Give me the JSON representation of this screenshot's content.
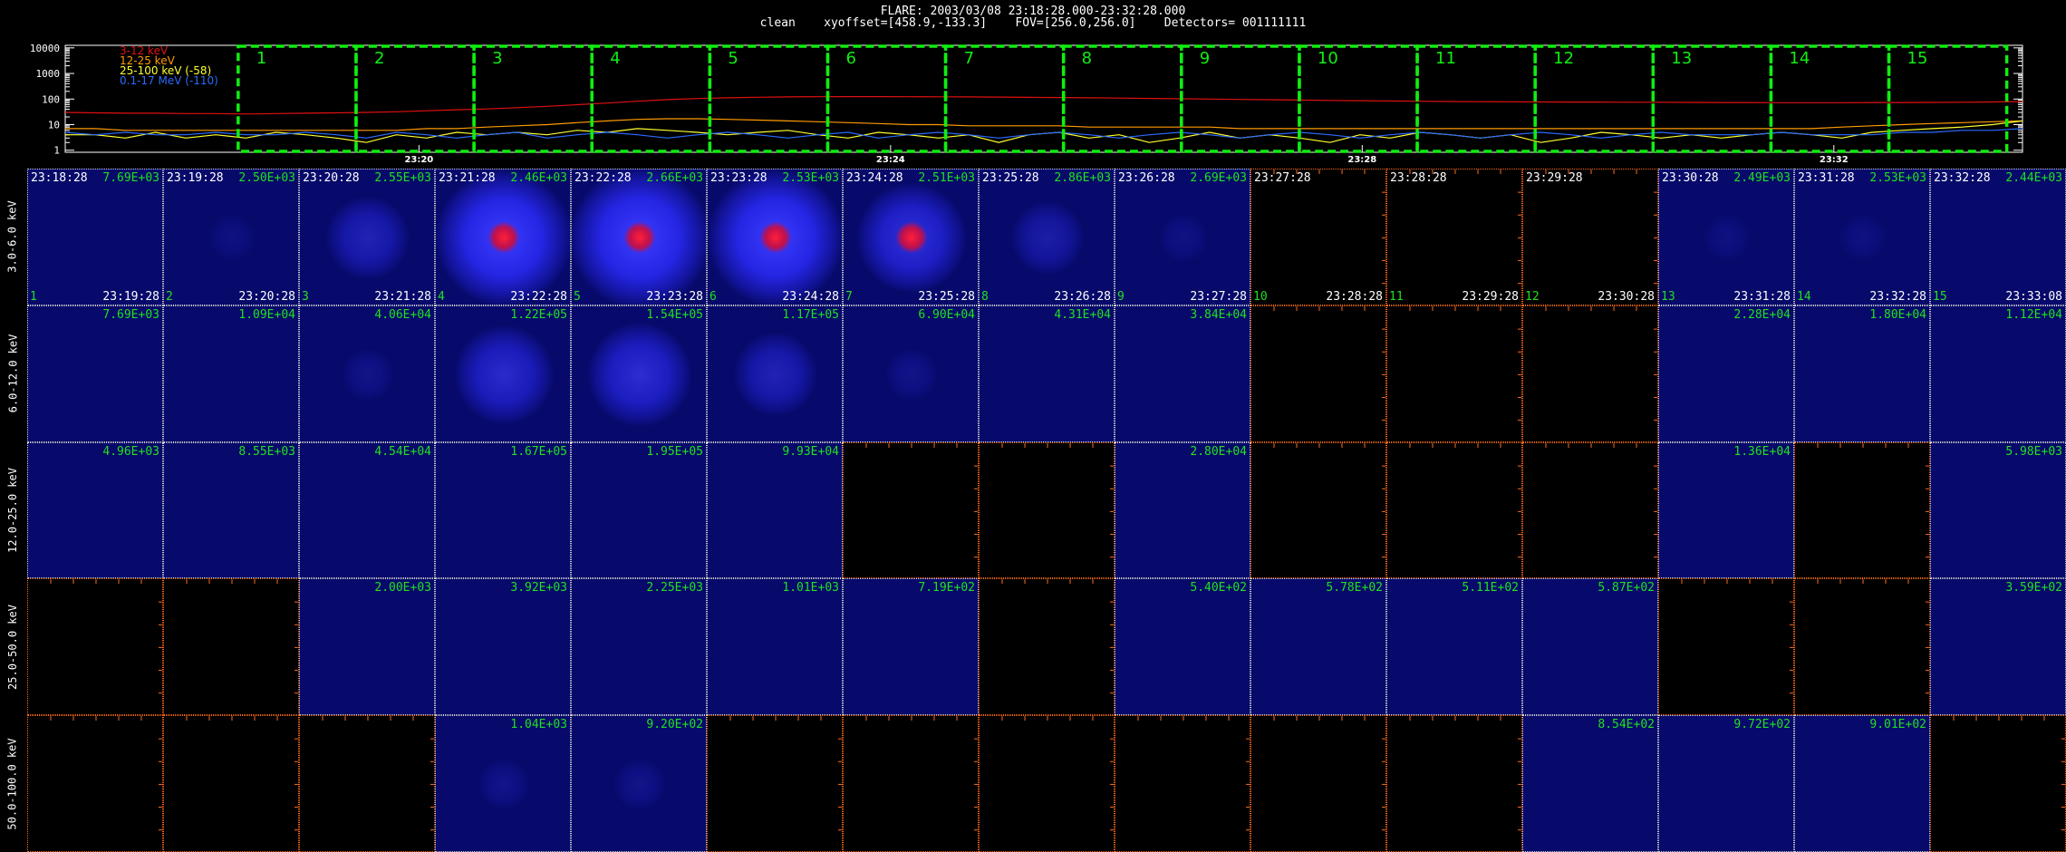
{
  "header": {
    "line1": "FLARE: 2003/03/08 23:18:28.000-23:32:28.000",
    "line2": "clean    xyoffset=[458.9,-133.3]    FOV=[256.0,256.0]    Detectors= 001111111"
  },
  "colors": {
    "background": "#000000",
    "band_3_12": "#e01010",
    "band_12_25": "#ff9a00",
    "band_25_100": "#ffff30",
    "band_01_17": "#2a6bff",
    "interval_box": "#10ee10",
    "max_label": "#20e020",
    "blank_border": "#ff6a1a"
  },
  "lightcurve": {
    "y_ticks": [
      "10000",
      "1000",
      "100",
      "10",
      "1"
    ],
    "time_ticks": [
      "23:20",
      "23:24",
      "23:28",
      "23:32"
    ],
    "legend": [
      {
        "label": "3-12 keV",
        "color": "#e01010"
      },
      {
        "label": "12-25 keV",
        "color": "#ff9a00"
      },
      {
        "label": "25-100 keV (-58)",
        "color": "#ffff30"
      },
      {
        "label": "0.1-17 MeV (-110)",
        "color": "#2a6bff"
      }
    ],
    "intervals": [
      "1",
      "2",
      "3",
      "4",
      "5",
      "6",
      "7",
      "8",
      "9",
      "10",
      "11",
      "12",
      "13",
      "14",
      "15"
    ],
    "series": {
      "band_3_12": [
        30,
        29,
        28,
        28,
        27,
        27,
        26,
        27,
        28,
        29,
        30,
        32,
        35,
        38,
        41,
        46,
        52,
        60,
        70,
        82,
        95,
        105,
        112,
        118,
        121,
        123,
        124,
        124,
        123,
        122,
        121,
        119,
        117,
        115,
        112,
        109,
        106,
        103,
        100,
        97,
        94,
        91,
        88,
        86,
        84,
        82,
        80,
        79,
        78,
        77,
        76,
        76,
        75,
        75,
        74,
        73,
        73,
        72,
        72,
        72,
        73,
        73,
        74,
        75,
        77,
        80
      ],
      "band_12_25": [
        7,
        7,
        6,
        6,
        6,
        6,
        6,
        6,
        6,
        6,
        6,
        6,
        7,
        7,
        8,
        9,
        10,
        12,
        14,
        16,
        17,
        17,
        16,
        15,
        14,
        13,
        12,
        11,
        10,
        10,
        9,
        9,
        9,
        9,
        8,
        8,
        8,
        8,
        8,
        7,
        7,
        7,
        7,
        7,
        7,
        7,
        7,
        7,
        7,
        7,
        7,
        7,
        7,
        7,
        7,
        7,
        7,
        7,
        7,
        8,
        9,
        10,
        11,
        12,
        13,
        14
      ],
      "band_25_100": [
        4,
        4,
        3,
        5,
        3,
        4,
        3,
        5,
        4,
        3,
        2,
        4,
        3,
        5,
        4,
        5,
        4,
        6,
        5,
        7,
        6,
        5,
        4,
        5,
        6,
        4,
        3,
        5,
        4,
        3,
        4,
        2,
        4,
        5,
        3,
        4,
        2,
        3,
        5,
        3,
        4,
        3,
        2,
        4,
        3,
        5,
        4,
        3,
        4,
        2,
        3,
        5,
        4,
        3,
        4,
        3,
        4,
        5,
        4,
        3,
        5,
        6,
        7,
        8,
        10,
        14
      ],
      "band_01_17": [
        5,
        4,
        5,
        4,
        4,
        5,
        4,
        4,
        5,
        4,
        3,
        5,
        4,
        3,
        4,
        5,
        3,
        4,
        5,
        4,
        3,
        4,
        5,
        4,
        3,
        4,
        5,
        3,
        4,
        5,
        4,
        3,
        4,
        5,
        4,
        3,
        4,
        5,
        4,
        3,
        4,
        5,
        4,
        3,
        4,
        5,
        4,
        3,
        4,
        5,
        4,
        3,
        4,
        5,
        4,
        4,
        4,
        5,
        4,
        4,
        4,
        5,
        5,
        6,
        6,
        7
      ]
    }
  },
  "grid": {
    "rows": [
      {
        "label": "3.0-6.0 keV",
        "cells": [
          {
            "t1": "23:18:28",
            "t2": "23:19:28",
            "idx": "1",
            "max": "7.69E+03",
            "img": 0.05
          },
          {
            "t1": "23:19:28",
            "t2": "23:20:28",
            "idx": "2",
            "max": "2.50E+03",
            "img": 0.1
          },
          {
            "t1": "23:20:28",
            "t2": "23:21:28",
            "idx": "3",
            "max": "2.55E+03",
            "img": 0.45
          },
          {
            "t1": "23:21:28",
            "t2": "23:22:28",
            "idx": "4",
            "max": "2.46E+03",
            "img": 0.95,
            "core": true
          },
          {
            "t1": "23:22:28",
            "t2": "23:23:28",
            "idx": "5",
            "max": "2.66E+03",
            "img": 1.0,
            "core": true
          },
          {
            "t1": "23:23:28",
            "t2": "23:24:28",
            "idx": "6",
            "max": "2.53E+03",
            "img": 0.95,
            "core": true
          },
          {
            "t1": "23:24:28",
            "t2": "23:25:28",
            "idx": "7",
            "max": "2.51E+03",
            "img": 0.7,
            "core": true
          },
          {
            "t1": "23:25:28",
            "t2": "23:26:28",
            "idx": "8",
            "max": "2.86E+03",
            "img": 0.35
          },
          {
            "t1": "23:26:28",
            "t2": "23:27:28",
            "idx": "9",
            "max": "2.69E+03",
            "img": 0.12
          },
          {
            "t1": "23:27:28",
            "t2": "23:28:28",
            "idx": "10",
            "max": "",
            "img": -1
          },
          {
            "t1": "23:28:28",
            "t2": "23:29:28",
            "idx": "11",
            "max": "",
            "img": -1
          },
          {
            "t1": "23:29:28",
            "t2": "23:30:28",
            "idx": "12",
            "max": "",
            "img": -1
          },
          {
            "t1": "23:30:28",
            "t2": "23:31:28",
            "idx": "13",
            "max": "2.49E+03",
            "img": 0.1
          },
          {
            "t1": "23:31:28",
            "t2": "23:32:28",
            "idx": "14",
            "max": "2.53E+03",
            "img": 0.1
          },
          {
            "t1": "23:32:28",
            "t2": "23:33:08",
            "idx": "15",
            "max": "2.44E+03",
            "img": 0.05
          }
        ]
      },
      {
        "label": "6.0-12.0 keV",
        "cells": [
          {
            "max": "7.69E+03",
            "img": 0.05
          },
          {
            "max": "1.09E+04",
            "img": 0.05
          },
          {
            "max": "4.06E+04",
            "img": 0.15
          },
          {
            "max": "1.22E+05",
            "img": 0.6
          },
          {
            "max": "1.54E+05",
            "img": 0.65
          },
          {
            "max": "1.17E+05",
            "img": 0.45
          },
          {
            "max": "6.90E+04",
            "img": 0.15
          },
          {
            "max": "4.31E+04",
            "img": 0.05
          },
          {
            "max": "3.84E+04",
            "img": 0.05
          },
          {
            "max": "",
            "img": -1
          },
          {
            "max": "",
            "img": -1
          },
          {
            "max": "",
            "img": -1
          },
          {
            "max": "2.28E+04",
            "img": 0.05
          },
          {
            "max": "1.80E+04",
            "img": 0.05
          },
          {
            "max": "1.12E+04",
            "img": 0.05
          }
        ]
      },
      {
        "label": "12.0-25.0 keV",
        "cells": [
          {
            "max": "4.96E+03",
            "img": 0.05
          },
          {
            "max": "8.55E+03",
            "img": 0.05
          },
          {
            "max": "4.54E+04",
            "img": 0.05
          },
          {
            "max": "1.67E+05",
            "img": 0.05
          },
          {
            "max": "1.95E+05",
            "img": 0.05
          },
          {
            "max": "9.93E+04",
            "img": 0.05
          },
          {
            "max": "",
            "img": -1
          },
          {
            "max": "",
            "img": -1
          },
          {
            "max": "2.80E+04",
            "img": 0.05
          },
          {
            "max": "",
            "img": -1
          },
          {
            "max": "",
            "img": -1
          },
          {
            "max": "",
            "img": -1
          },
          {
            "max": "1.36E+04",
            "img": 0.05
          },
          {
            "max": "",
            "img": -1
          },
          {
            "max": "5.98E+03",
            "img": 0.05
          }
        ]
      },
      {
        "label": "25.0-50.0 keV",
        "cells": [
          {
            "max": "",
            "img": -1
          },
          {
            "max": "",
            "img": -1
          },
          {
            "max": "2.00E+03",
            "img": 0.05
          },
          {
            "max": "3.92E+03",
            "img": 0.05
          },
          {
            "max": "2.25E+03",
            "img": 0.05
          },
          {
            "max": "1.01E+03",
            "img": 0.05
          },
          {
            "max": "7.19E+02",
            "img": 0.05
          },
          {
            "max": "",
            "img": -1
          },
          {
            "max": "5.40E+02",
            "img": 0.05
          },
          {
            "max": "5.78E+02",
            "img": 0.05
          },
          {
            "max": "5.11E+02",
            "img": 0.05
          },
          {
            "max": "5.87E+02",
            "img": 0.05
          },
          {
            "max": "",
            "img": -1
          },
          {
            "max": "",
            "img": -1
          },
          {
            "max": "3.59E+02",
            "img": 0.05
          }
        ]
      },
      {
        "label": "50.0-100.0 keV",
        "cells": [
          {
            "max": "",
            "img": -1
          },
          {
            "max": "",
            "img": -1
          },
          {
            "max": "",
            "img": -1
          },
          {
            "max": "1.04E+03",
            "img": 0.15
          },
          {
            "max": "9.20E+02",
            "img": 0.15
          },
          {
            "max": "",
            "img": -1
          },
          {
            "max": "",
            "img": -1
          },
          {
            "max": "",
            "img": -1
          },
          {
            "max": "",
            "img": -1
          },
          {
            "max": "",
            "img": -1
          },
          {
            "max": "",
            "img": -1
          },
          {
            "max": "8.54E+02",
            "img": 0.08
          },
          {
            "max": "9.72E+02",
            "img": 0.08
          },
          {
            "max": "9.01E+02",
            "img": 0.08
          },
          {
            "max": "",
            "img": -1
          }
        ]
      }
    ]
  }
}
